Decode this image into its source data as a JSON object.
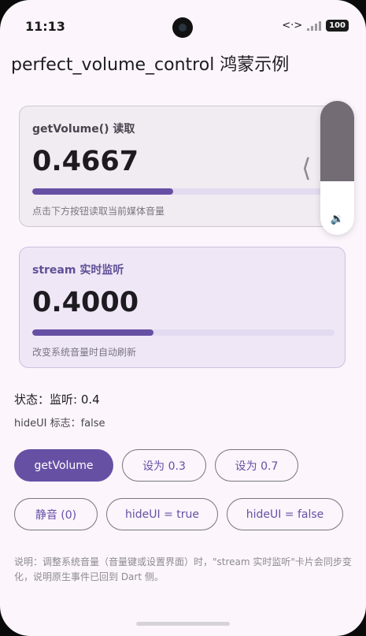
{
  "status_bar": {
    "time": "11:13",
    "battery": "100"
  },
  "app_bar": {
    "title": "perfect_volume_control 鸿蒙示例"
  },
  "card_get": {
    "label": "getVolume() 读取",
    "value": "0.4667",
    "progress": 0.4667,
    "hint": "点击下方按钮读取当前媒体音量"
  },
  "card_stream": {
    "label": "stream 实时监听",
    "value": "0.4000",
    "progress": 0.4,
    "hint": "改变系统音量时自动刷新"
  },
  "volume_overlay": {
    "level": 0.4,
    "icon": "speaker-icon"
  },
  "state": {
    "status_text": "状态：监听: 0.4",
    "hide_ui_flag": "hideUI 标志：false"
  },
  "buttons": {
    "get_volume": "getVolume",
    "set_03": "设为 0.3",
    "set_07": "设为 0.7",
    "mute": "静音 (0)",
    "hide_true": "hideUI = true",
    "hide_false": "hideUI = false"
  },
  "note": "说明：调整系统音量（音量键或设置界面）时，\"stream 实时监听\"卡片会同步变化，说明原生事件已回到 Dart 侧。",
  "colors": {
    "primary": "#6650a4",
    "background": "#fcf5fc"
  }
}
